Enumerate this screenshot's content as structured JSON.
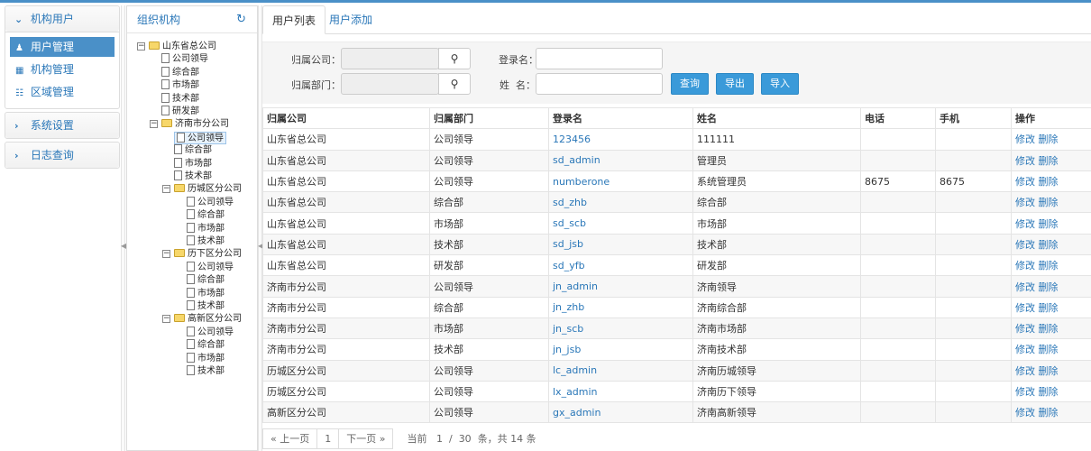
{
  "left_menu": {
    "sections": [
      {
        "title": "机构用户",
        "chevron": "down",
        "items": [
          {
            "label": "用户管理",
            "icon": "user-icon",
            "active": true
          },
          {
            "label": "机构管理",
            "icon": "grid-icon",
            "active": false
          },
          {
            "label": "区域管理",
            "icon": "list-icon",
            "active": false
          }
        ]
      },
      {
        "title": "系统设置",
        "chevron": "right"
      },
      {
        "title": "日志查询",
        "chevron": "right"
      }
    ]
  },
  "tree": {
    "title": "组织机构",
    "nodes": [
      {
        "label": "山东省总公司",
        "type": "folder",
        "level": 0
      },
      {
        "label": "公司领导",
        "type": "file",
        "level": 1
      },
      {
        "label": "综合部",
        "type": "file",
        "level": 1
      },
      {
        "label": "市场部",
        "type": "file",
        "level": 1
      },
      {
        "label": "技术部",
        "type": "file",
        "level": 1
      },
      {
        "label": "研发部",
        "type": "file",
        "level": 1
      },
      {
        "label": "济南市分公司",
        "type": "folder",
        "level": 1
      },
      {
        "label": "公司领导",
        "type": "file",
        "level": 2,
        "selected": true
      },
      {
        "label": "综合部",
        "type": "file",
        "level": 2
      },
      {
        "label": "市场部",
        "type": "file",
        "level": 2
      },
      {
        "label": "技术部",
        "type": "file",
        "level": 2
      },
      {
        "label": "历城区分公司",
        "type": "folder",
        "level": 2
      },
      {
        "label": "公司领导",
        "type": "file",
        "level": 3
      },
      {
        "label": "综合部",
        "type": "file",
        "level": 3
      },
      {
        "label": "市场部",
        "type": "file",
        "level": 3
      },
      {
        "label": "技术部",
        "type": "file",
        "level": 3
      },
      {
        "label": "历下区分公司",
        "type": "folder",
        "level": 2
      },
      {
        "label": "公司领导",
        "type": "file",
        "level": 3
      },
      {
        "label": "综合部",
        "type": "file",
        "level": 3
      },
      {
        "label": "市场部",
        "type": "file",
        "level": 3
      },
      {
        "label": "技术部",
        "type": "file",
        "level": 3
      },
      {
        "label": "高新区分公司",
        "type": "folder",
        "level": 2
      },
      {
        "label": "公司领导",
        "type": "file",
        "level": 3
      },
      {
        "label": "综合部",
        "type": "file",
        "level": 3
      },
      {
        "label": "市场部",
        "type": "file",
        "level": 3
      },
      {
        "label": "技术部",
        "type": "file",
        "level": 3
      }
    ]
  },
  "tabs": [
    {
      "label": "用户列表",
      "active": true
    },
    {
      "label": "用户添加",
      "active": false
    }
  ],
  "search": {
    "company_label": "归属公司：",
    "dept_label": "归属部门：",
    "login_label": "登录名：",
    "name_label": "姓  名：",
    "company_value": "",
    "dept_value": "",
    "login_value": "",
    "name_value": "",
    "query_btn": "查询",
    "export_btn": "导出",
    "import_btn": "导入"
  },
  "table": {
    "columns": [
      "归属公司",
      "归属部门",
      "登录名",
      "姓名",
      "电话",
      "手机",
      "操作"
    ],
    "edit_label": "修改",
    "delete_label": "删除",
    "rows": [
      [
        "山东省总公司",
        "公司领导",
        "123456",
        "111111",
        "",
        ""
      ],
      [
        "山东省总公司",
        "公司领导",
        "sd_admin",
        "管理员",
        "",
        ""
      ],
      [
        "山东省总公司",
        "公司领导",
        "numberone",
        "系统管理员",
        "8675",
        "8675"
      ],
      [
        "山东省总公司",
        "综合部",
        "sd_zhb",
        "综合部",
        "",
        ""
      ],
      [
        "山东省总公司",
        "市场部",
        "sd_scb",
        "市场部",
        "",
        ""
      ],
      [
        "山东省总公司",
        "技术部",
        "sd_jsb",
        "技术部",
        "",
        ""
      ],
      [
        "山东省总公司",
        "研发部",
        "sd_yfb",
        "研发部",
        "",
        ""
      ],
      [
        "济南市分公司",
        "公司领导",
        "jn_admin",
        "济南领导",
        "",
        ""
      ],
      [
        "济南市分公司",
        "综合部",
        "jn_zhb",
        "济南综合部",
        "",
        ""
      ],
      [
        "济南市分公司",
        "市场部",
        "jn_scb",
        "济南市场部",
        "",
        ""
      ],
      [
        "济南市分公司",
        "技术部",
        "jn_jsb",
        "济南技术部",
        "",
        ""
      ],
      [
        "历城区分公司",
        "公司领导",
        "lc_admin",
        "济南历城领导",
        "",
        ""
      ],
      [
        "历城区分公司",
        "公司领导",
        "lx_admin",
        "济南历下领导",
        "",
        ""
      ],
      [
        "高新区分公司",
        "公司领导",
        "gx_admin",
        "济南高新领导",
        "",
        ""
      ]
    ]
  },
  "pager": {
    "prev": "« 上一页",
    "current": "1",
    "next": "下一页 »",
    "info_prefix": "当前",
    "page": "1",
    "slash": "/",
    "total_pages": "30",
    "info_suffix": "条，共 14 条"
  }
}
